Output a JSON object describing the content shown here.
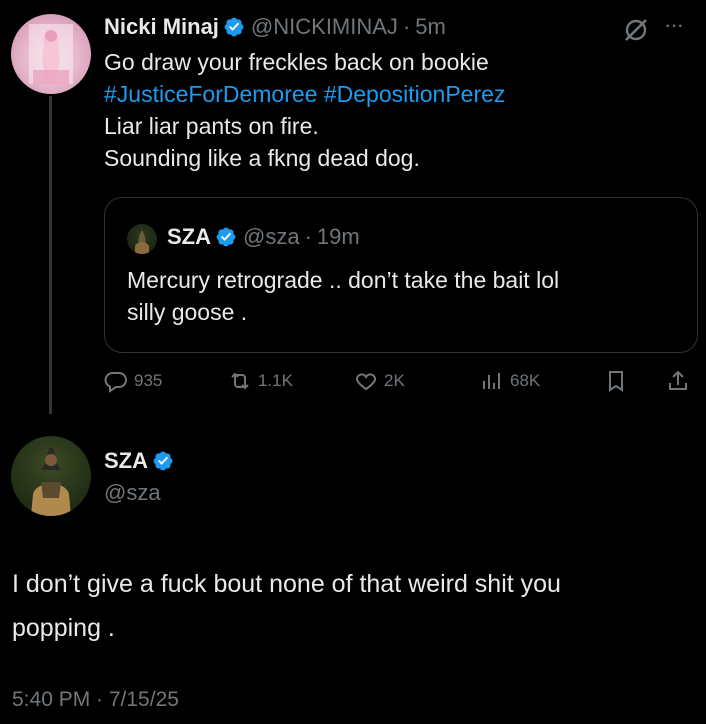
{
  "post1": {
    "name": "Nicki Minaj",
    "handle": "@NICKIMINAJ",
    "sep": "·",
    "time": "5m",
    "line1": "Go draw your freckles back on bookie",
    "hashtag1": "#JusticeForDemoree",
    "hashtag2": "#DepositionPerez",
    "line3": "Liar liar pants on fire.",
    "line4": "Sounding like a fkng dead dog.",
    "more": "···",
    "quote": {
      "name": "SZA",
      "handle": "@sza",
      "sep": "·",
      "time": "19m",
      "line1": "Mercury retrograde .. don’t take the bait lol",
      "line2": "silly goose ."
    },
    "actions": {
      "replies": "935",
      "reposts": "1.1K",
      "likes": "2K",
      "views": "68K"
    }
  },
  "post2": {
    "name": "SZA",
    "handle": "@sza",
    "line1": "I don’t give a fuck bout none of that weird shit you",
    "line2": "popping .",
    "timestamp": "5:40 PM · 7/15/25"
  },
  "colors": {
    "background": "#000000",
    "text": "#e7e9ea",
    "secondary": "#71767b",
    "accent": "#1d9bf0"
  }
}
